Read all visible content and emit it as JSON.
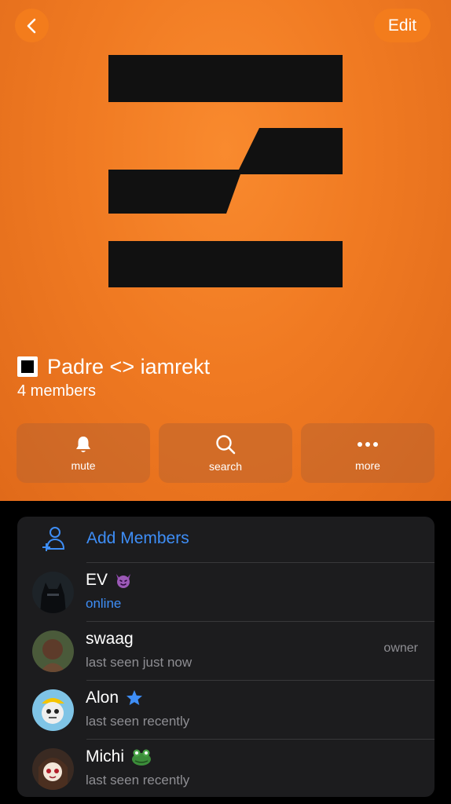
{
  "header": {
    "edit_label": "Edit"
  },
  "group": {
    "title": "Padre <> iamrekt",
    "members_count": "4 members"
  },
  "actions": [
    {
      "label": "mute",
      "icon": "bell-icon"
    },
    {
      "label": "search",
      "icon": "search-icon"
    },
    {
      "label": "more",
      "icon": "more-dots-icon"
    }
  ],
  "add_members_label": "Add Members",
  "members": [
    {
      "name": "EV",
      "status": "online",
      "badge": "devil-emoji"
    },
    {
      "name": "swaag",
      "status": "last seen just now",
      "role": "owner"
    },
    {
      "name": "Alon",
      "status": "last seen recently",
      "badge": "star-icon"
    },
    {
      "name": "Michi",
      "status": "last seen recently",
      "badge": "frog-emoji"
    }
  ],
  "colors": {
    "accent": "#3e8ef7",
    "hero": "#f07a22",
    "card": "#1c1c1e"
  }
}
